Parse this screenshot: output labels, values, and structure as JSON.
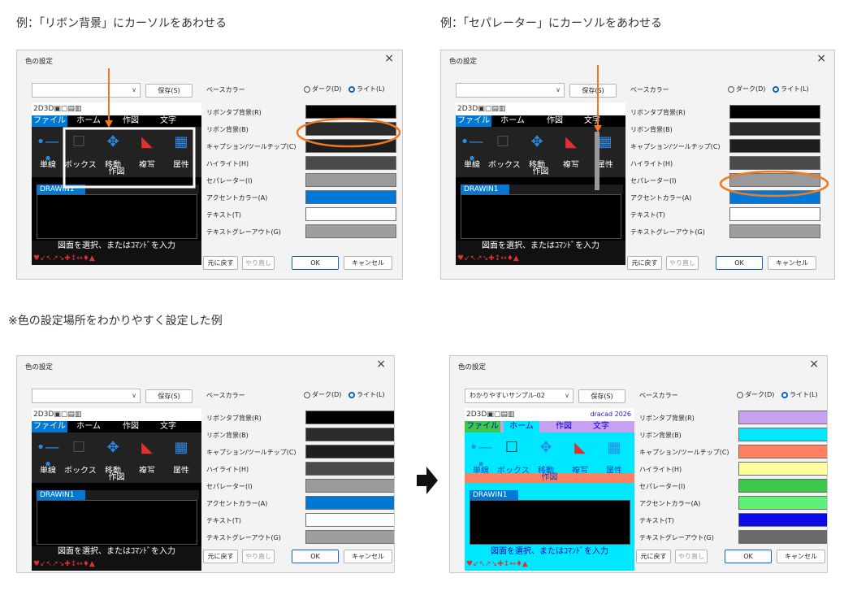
{
  "captions": {
    "top_left": "例：「リボン背景」にカーソルをあわせる",
    "top_right": "例：「セパレーター」にカーソルをあわせる",
    "middle": "※色の設定場所をわかりやすく設定した例"
  },
  "dialog": {
    "title": "色の設定",
    "close": "×",
    "save_button": "保存(S)",
    "base_color_label": "ベースカラー",
    "radio_dark": "ダーク(D)",
    "radio_light": "ライト(L)",
    "revert_button": "元に戻す",
    "redo_button": "やり直し",
    "ok_button": "OK",
    "cancel_button": "キャンセル",
    "rows": [
      "リボンタブ背景(R)",
      "リボン背景(B)",
      "キャプション/ツールチップ(C)",
      "ハイライト(H)",
      "セパレーター(I)",
      "アクセントカラー(A)",
      "テキスト(T)",
      "テキストグレーアウト(G)"
    ]
  },
  "preview": {
    "toolbar": "2D3D▣▢▤▥",
    "tabs": [
      "ファイル",
      "ホーム",
      "作図",
      "文字"
    ],
    "ribbon_labels": [
      "単線",
      "ボックス",
      "移動",
      "複写",
      "属性"
    ],
    "group_label": "作図",
    "doc_tab": "DRAWIN1",
    "status": "図面を選択、またはｺﾏﾝﾄﾞを入力",
    "bottom_icons": "♥↙↖↗↘✚↕↔♦▲",
    "custom_brand": "dracad 2026"
  },
  "custom_combo_value": "わかりやすいサンプル-02",
  "colors": {
    "default_swatches": [
      "#000000",
      "#2b2b2b",
      "#1e1e1e",
      "#4a4a4a",
      "#9a9a9a",
      "#0078d7",
      "#ffffff",
      "#9e9e9e"
    ],
    "custom_swatches": [
      "#c8a0f0",
      "#00e8ff",
      "#ff8060",
      "#ffff9c",
      "#3cc84b",
      "#5ff07a",
      "#0a0ae6",
      "#6a6a6a"
    ],
    "highlight_orange": "#f07820"
  }
}
